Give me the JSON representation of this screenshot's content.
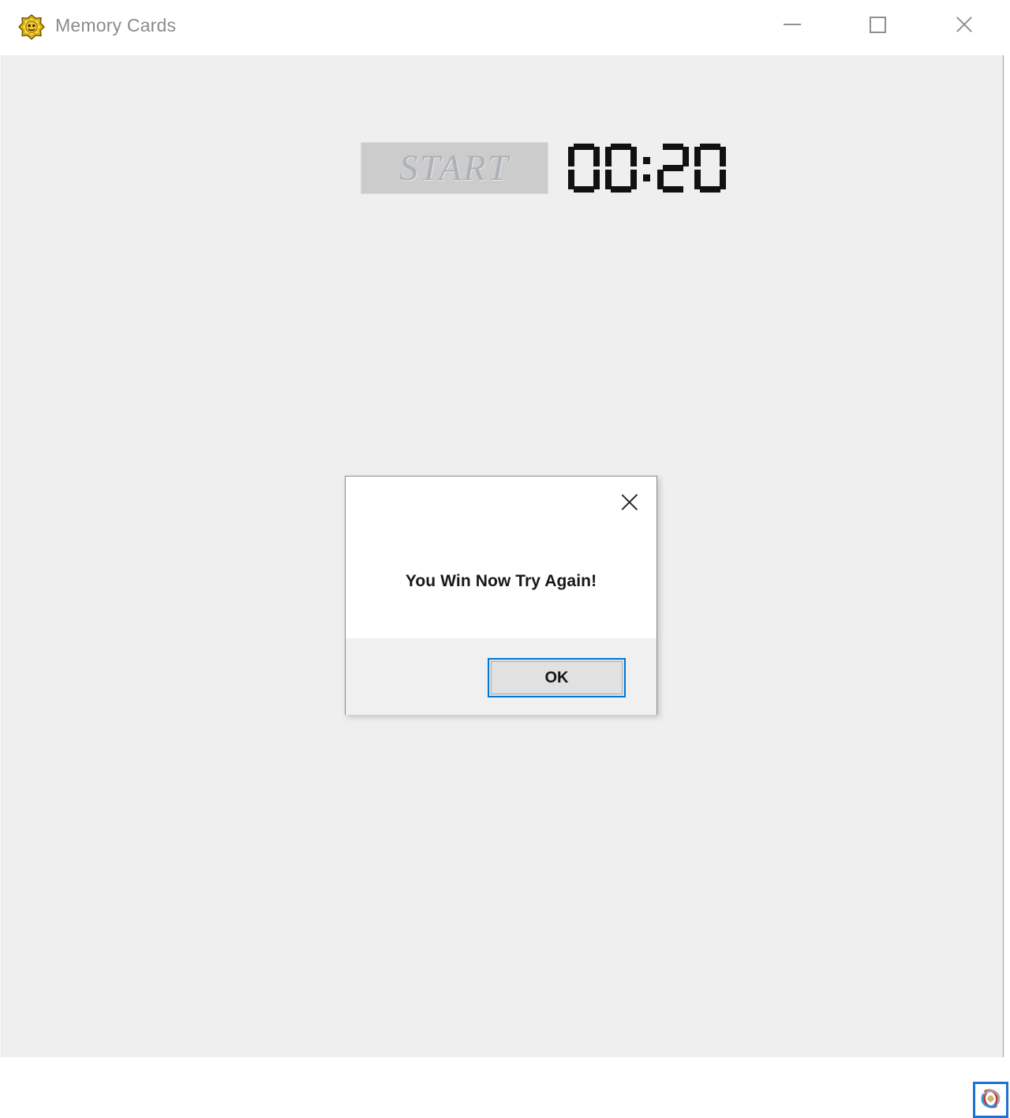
{
  "window": {
    "title": "Memory Cards",
    "icon": "star-flower-icon",
    "background_color": "#efefef",
    "titlebar_color": "#ffffff"
  },
  "titlebar_buttons": [
    {
      "name": "minimize",
      "label": "—"
    },
    {
      "name": "maximize",
      "label": "□"
    },
    {
      "name": "close",
      "label": "✕"
    }
  ],
  "game": {
    "start_button_label": "START",
    "start_button_enabled": false,
    "timer_value": "00:20",
    "timer_digits": [
      "0",
      "0",
      ":",
      "2",
      "0"
    ]
  },
  "dialog": {
    "message": "You Win Now Try Again!",
    "ok_label": "OK",
    "close_icon": "close-icon",
    "accent_color": "#0078d7",
    "body_color": "#ffffff",
    "footer_color": "#f0f0f0"
  },
  "corner_badge": {
    "icon": "atom-swirl-icon",
    "border_color": "#1b72d4"
  }
}
